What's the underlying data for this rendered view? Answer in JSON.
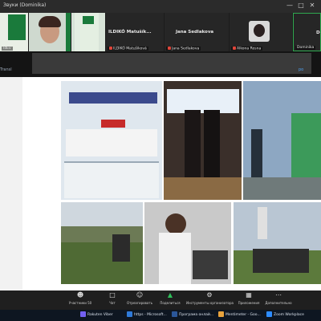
{
  "window": {
    "title": "Звуки (Dominika)",
    "controls": [
      "—",
      "□",
      "✕"
    ]
  },
  "participants": [
    {
      "name": "IdEv",
      "shown": "tile1"
    },
    {
      "name": "",
      "shown": "tile2"
    },
    {
      "name": "ILDIKÓ Matušík...",
      "label": "ILDIKÓ Matušíková"
    },
    {
      "name": "Jana Sedlakova",
      "label": "Jana Sedlakova"
    },
    {
      "name": "",
      "label": "Alkona Rosna"
    },
    {
      "name": "Do",
      "label": "Dominika"
    }
  ],
  "share": {
    "left_label": "Transl",
    "right_label": "po"
  },
  "toolbar": [
    {
      "icon": "mic-icon",
      "label": "Участники",
      "count": "50"
    },
    {
      "icon": "chat-icon",
      "label": "Чат"
    },
    {
      "icon": "react-icon",
      "label": "Отреагировать"
    },
    {
      "icon": "share-icon",
      "label": "Поделиться"
    },
    {
      "icon": "host-tools-icon",
      "label": "Инструменты организатора"
    },
    {
      "icon": "apps-icon",
      "label": "Приложения"
    },
    {
      "icon": "more-icon",
      "label": "Дополнительно"
    }
  ],
  "taskbar": [
    {
      "label": "Rakuten Viber",
      "color": "#7360f2"
    },
    {
      "label": "https - Microsoft...",
      "color": "#2f7ad9"
    },
    {
      "label": "Програма онлай...",
      "color": "#2b579a"
    },
    {
      "label": "Mentimeter - Goo...",
      "color": "#e8a33d"
    },
    {
      "label": "Zoom Workplace",
      "color": "#2d8cff"
    }
  ],
  "colors": {
    "accent_green": "#1a7a3b",
    "zoom_blue": "#2d8cff"
  }
}
